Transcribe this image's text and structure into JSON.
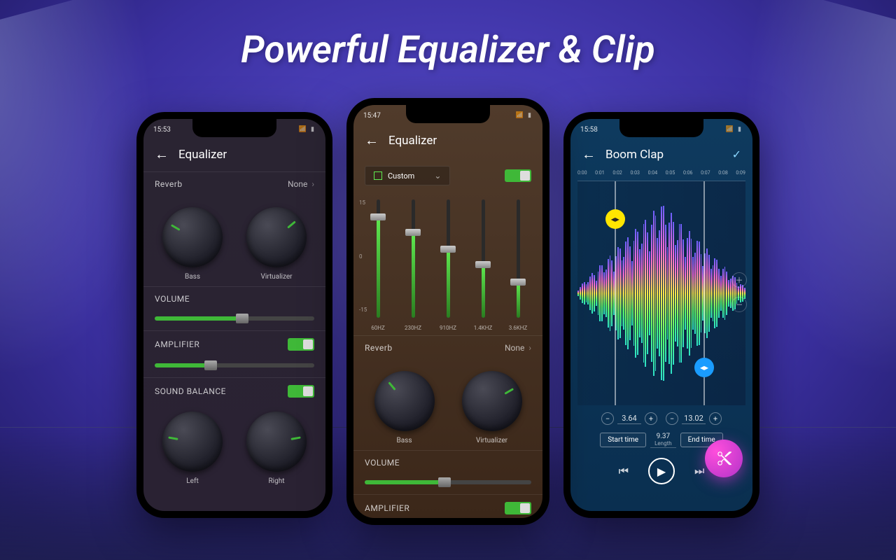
{
  "headline": "Powerful Equalizer & Clip",
  "phone1": {
    "time": "15:53",
    "title": "Equalizer",
    "reverb": {
      "label": "Reverb",
      "value": "None"
    },
    "knobs": {
      "bass": "Bass",
      "virtualizer": "Virtualizer"
    },
    "volume_label": "VOLUME",
    "volume_pct": 55,
    "amplifier_label": "AMPLIFIER",
    "amp_pct": 35,
    "sound_balance_label": "SOUND BALANCE",
    "balance": {
      "left": "Left",
      "right": "Right"
    }
  },
  "phone2": {
    "time": "15:47",
    "title": "Equalizer",
    "preset": "Custom",
    "eq_scale": {
      "top": "15",
      "mid": "0",
      "bottom": "-15"
    },
    "bands": [
      {
        "freq": "60HZ",
        "val": 85
      },
      {
        "freq": "230HZ",
        "val": 72
      },
      {
        "freq": "910HZ",
        "val": 58
      },
      {
        "freq": "1.4KHZ",
        "val": 45
      },
      {
        "freq": "3.6KHZ",
        "val": 30
      }
    ],
    "reverb": {
      "label": "Reverb",
      "value": "None"
    },
    "knobs": {
      "bass": "Bass",
      "virtualizer": "Virtualizer"
    },
    "volume_label": "VOLUME",
    "volume_pct": 48,
    "amplifier_label": "AMPLIFIER"
  },
  "phone3": {
    "time": "15:58",
    "title": "Boom Clap",
    "ruler": [
      "0:00",
      "0:01",
      "0:02",
      "0:03",
      "0:04",
      "0:05",
      "0:06",
      "0:07",
      "0:08",
      "0:09"
    ],
    "start_value": "3.64",
    "end_value": "13.02",
    "start_btn": "Start time",
    "end_btn": "End time",
    "length_value": "9.37",
    "length_label": "Length"
  }
}
